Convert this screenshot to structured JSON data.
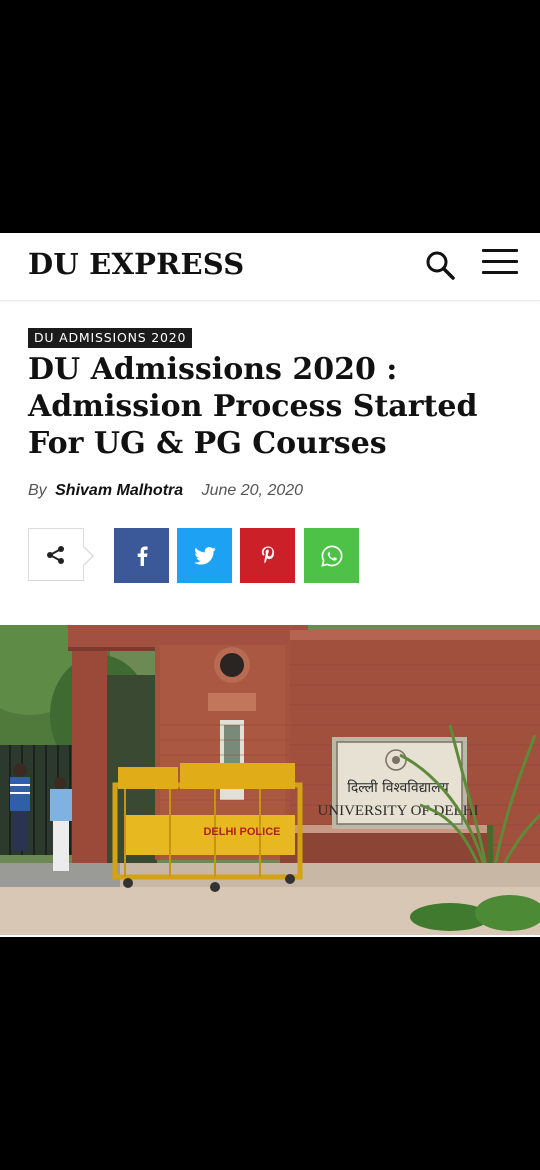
{
  "header": {
    "site_title": "DU EXPRESS",
    "search_icon": "search-icon",
    "menu_icon": "hamburger-menu-icon"
  },
  "article": {
    "category": "DU ADMISSIONS 2020",
    "title": "DU Admissions 2020 : Admission Process Started For UG & PG Courses",
    "by_label": "By",
    "author": "Shivam Malhotra",
    "date": "June 20, 2020"
  },
  "share": {
    "toggle_icon": "share-icon",
    "buttons": [
      {
        "network": "facebook",
        "icon": "facebook-icon",
        "color": "#3b5998"
      },
      {
        "network": "twitter",
        "icon": "twitter-icon",
        "color": "#1da1f2"
      },
      {
        "network": "pinterest",
        "icon": "pinterest-icon",
        "color": "#cb2027"
      },
      {
        "network": "whatsapp",
        "icon": "whatsapp-icon",
        "color": "#4dc247"
      }
    ]
  },
  "hero_image": {
    "sign_hindi": "दिल्ली विश्वविद्यालय",
    "sign_english": "UNIVERSITY OF DELHI",
    "barricade_text": "DELHI POLICE"
  }
}
